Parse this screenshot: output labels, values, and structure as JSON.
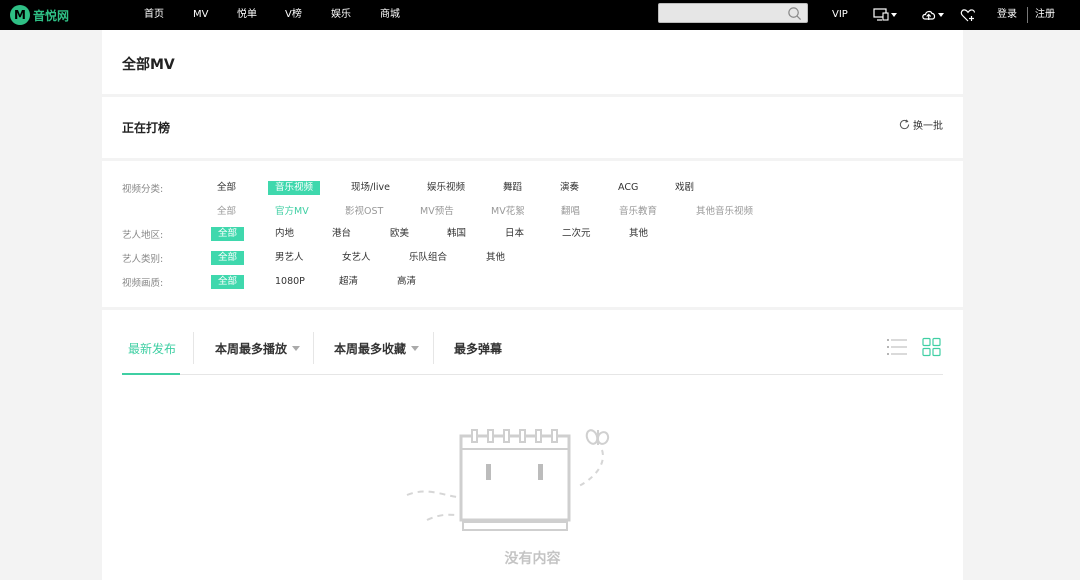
{
  "brand": {
    "mark": "M",
    "name": "音悦网"
  },
  "nav": {
    "items": [
      "首页",
      "MV",
      "悦单",
      "V榜",
      "娱乐",
      "商城"
    ]
  },
  "search": {
    "value": "",
    "placeholder": ""
  },
  "top_right": {
    "vip": "VIP",
    "login": "登录",
    "register": "注册"
  },
  "page": {
    "title": "全部MV"
  },
  "trending": {
    "title": "正在打榜",
    "refresh": "换一批"
  },
  "filters": {
    "category": {
      "label": "视频分类:",
      "items": [
        "全部",
        "音乐视频",
        "现场/live",
        "娱乐视频",
        "舞蹈",
        "演奏",
        "ACG",
        "戏剧"
      ],
      "selected": "音乐视频",
      "sub_items": [
        "全部",
        "官方MV",
        "影视OST",
        "MV预告",
        "MV花絮",
        "翻唱",
        "音乐教育",
        "其他音乐视频"
      ],
      "sub_selected": "官方MV"
    },
    "region": {
      "label": "艺人地区:",
      "items": [
        "全部",
        "内地",
        "港台",
        "欧美",
        "韩国",
        "日本",
        "二次元",
        "其他"
      ],
      "selected": "全部"
    },
    "artist_type": {
      "label": "艺人类别:",
      "items": [
        "全部",
        "男艺人",
        "女艺人",
        "乐队组合",
        "其他"
      ],
      "selected": "全部"
    },
    "quality": {
      "label": "视频画质:",
      "items": [
        "全部",
        "1080P",
        "超清",
        "高清"
      ],
      "selected": "全部"
    }
  },
  "sort_tabs": {
    "items": [
      "最新发布",
      "本周最多播放",
      "本周最多收藏",
      "最多弹幕"
    ],
    "active": "最新发布"
  },
  "empty": {
    "text": "没有内容"
  },
  "colors": {
    "accent": "#3fd8ad",
    "brand": "#2fbf85",
    "topbar": "#000000",
    "background": "#f3f3f3"
  }
}
